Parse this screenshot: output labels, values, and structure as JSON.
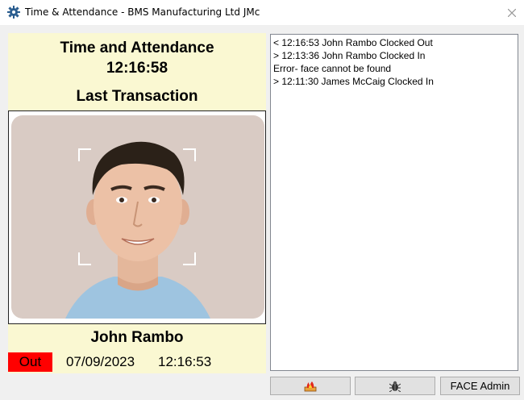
{
  "window": {
    "title": "Time & Attendance - BMS Manufacturing Ltd JMc",
    "icon": "app-gear-icon",
    "close_icon": "close-icon"
  },
  "panel": {
    "title": "Time and Attendance",
    "clock": "12:16:58",
    "last_transaction_label": "Last Transaction",
    "person_name": "John Rambo",
    "status": "Out",
    "date": "07/09/2023",
    "time": "12:16:53",
    "background_color": "#faf8d2",
    "status_color": "#ff0000"
  },
  "log": {
    "lines": [
      "< 12:16:53 John Rambo Clocked Out",
      "> 12:13:36 John Rambo Clocked In",
      "Error- face cannot be found",
      "> 12:11:30 James McCaig Clocked In"
    ]
  },
  "buttons": {
    "button1_icon": "fire-icon",
    "button2_icon": "bug-icon",
    "face_admin_label": "FACE Admin"
  }
}
